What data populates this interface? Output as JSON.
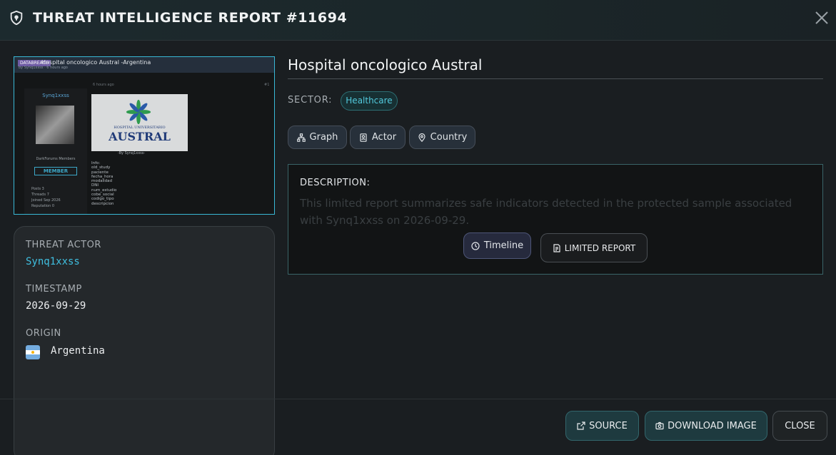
{
  "header": {
    "title": "THREAT INTELLIGENCE REPORT #11694",
    "icon": "shield-icon",
    "close_icon": "close-icon"
  },
  "thumbnail": {
    "tag": "DATABREACH",
    "title": "Hospital oncologico Austral -Argentina",
    "subtitle": "by Synq1xxss · 6 hours ago",
    "username": "Synq1xxss",
    "group": "DarkForums Members",
    "rank": "MEMBER",
    "stats": [
      {
        "label": "Posts",
        "value": "3"
      },
      {
        "label": "Threads",
        "value": "7"
      },
      {
        "label": "Joined",
        "value": "Sep 2026"
      },
      {
        "label": "Reputation",
        "value": "0"
      }
    ],
    "post_date": "6 hours ago",
    "post_num": "#1",
    "logo_line1": "HOSPITAL UNIVERSITARIO",
    "logo_line2": "AUSTRAL",
    "by_line": "-By Synq1xxss-",
    "info_lines": [
      "Info:",
      "old_study",
      "paciente",
      "fecha_hora",
      "modalidad",
      "DNI",
      "num_estudio",
      "cobe_social",
      "codigo_tipo",
      "descripcion"
    ]
  },
  "details": {
    "actor_label": "THREAT ACTOR",
    "actor_value": "Synq1xxss",
    "timestamp_label": "TIMESTAMP",
    "timestamp_value": "2026-09-29",
    "origin_label": "ORIGIN",
    "origin_value": "Argentina",
    "origin_flag": "argentina-flag"
  },
  "entity": {
    "name": "Hospital oncologico Austral",
    "sector_label": "SECTOR:",
    "sector_value": "Healthcare"
  },
  "tags": [
    {
      "label": "Graph",
      "icon": "graph-icon"
    },
    {
      "label": "Actor",
      "icon": "actor-icon"
    },
    {
      "label": "Country",
      "icon": "pin-icon"
    }
  ],
  "description": {
    "label": "DESCRIPTION:",
    "text": "This limited report summarizes safe indicators detected in the protected sample associated with Synq1xxss on 2026-09-29.",
    "timeline_label": "Timeline",
    "limited_label": "LIMITED REPORT"
  },
  "footer": {
    "source_label": "SOURCE",
    "download_label": "DOWNLOAD IMAGE",
    "close_label": "CLOSE"
  },
  "colors": {
    "accent": "#3fbfe0",
    "sector_pill_text": "#52c9dc",
    "border_highlight": "#39b8d6"
  }
}
